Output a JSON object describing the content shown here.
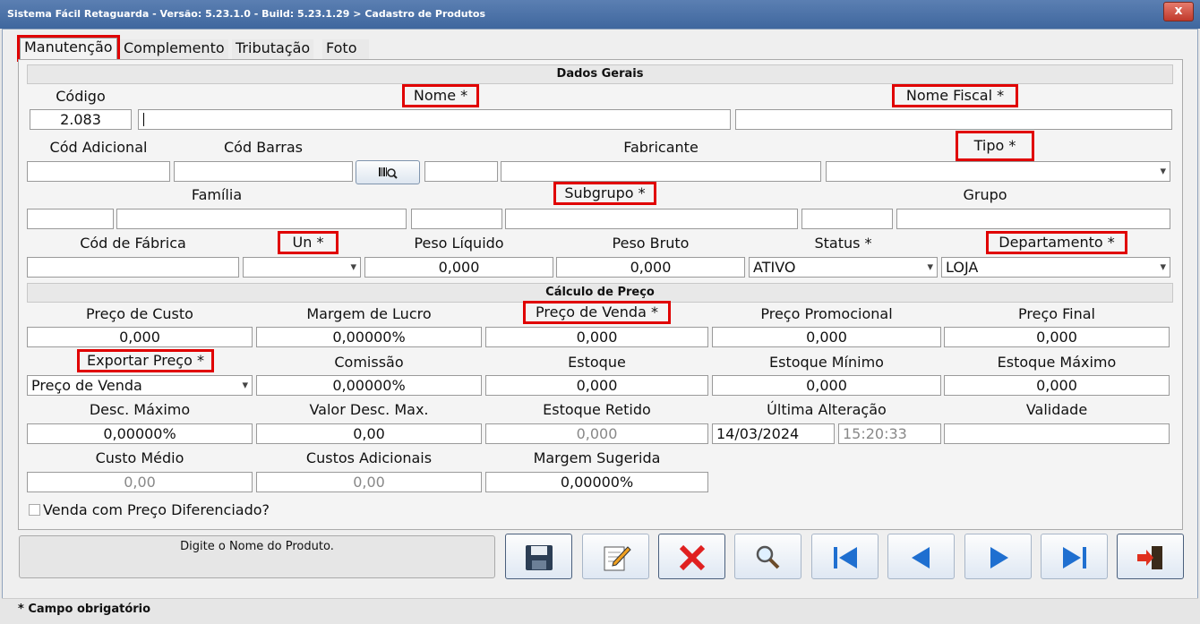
{
  "window": {
    "title": "Sistema Fácil Retaguarda - Versão: 5.23.1.0  - Build: 5.23.1.29 > Cadastro de Produtos",
    "close_label": "x"
  },
  "tabs": [
    "Manutenção",
    "Complemento",
    "Tributação",
    "Foto"
  ],
  "sections": {
    "general": "Dados Gerais",
    "price": "Cálculo de Preço"
  },
  "labels": {
    "codigo": "Código",
    "nome": "Nome *",
    "nome_fiscal": "Nome Fiscal *",
    "cod_adicional": "Cód Adicional",
    "cod_barras": "Cód Barras",
    "fabricante": "Fabricante",
    "tipo": "Tipo *",
    "familia": "Família",
    "subgrupo": "Subgrupo *",
    "grupo": "Grupo",
    "cod_fabrica": "Cód de Fábrica",
    "un": "Un *",
    "peso_liquido": "Peso Líquido",
    "peso_bruto": "Peso Bruto",
    "status": "Status *",
    "departamento": "Departamento *",
    "preco_custo": "Preço de Custo",
    "margem_lucro": "Margem de Lucro",
    "preco_venda": "Preço de Venda *",
    "preco_promocional": "Preço Promocional",
    "preco_final": "Preço Final",
    "exportar_preco": "Exportar Preço *",
    "comissao": "Comissão",
    "estoque": "Estoque",
    "estoque_minimo": "Estoque Mínimo",
    "estoque_maximo": "Estoque Máximo",
    "desc_maximo": "Desc. Máximo",
    "valor_desc_max": "Valor Desc. Max.",
    "estoque_retido": "Estoque Retido",
    "ultima_alteracao": "Última Alteração",
    "validade": "Validade",
    "custo_medio": "Custo Médio",
    "custos_adicionais": "Custos Adicionais",
    "margem_sugerida": "Margem Sugerida",
    "venda_diferenciada": "Venda com Preço Diferenciado?"
  },
  "values": {
    "codigo": "2.083",
    "nome": "",
    "nome_fiscal": "",
    "peso_liquido": "0,000",
    "peso_bruto": "0,000",
    "status": "ATIVO",
    "departamento": "LOJA",
    "preco_custo": "0,000",
    "margem_lucro": "0,00000%",
    "preco_venda": "0,000",
    "preco_promocional": "0,000",
    "preco_final": "0,000",
    "exportar_preco": "Preço de Venda",
    "comissao": "0,00000%",
    "estoque": "0,000",
    "estoque_minimo": "0,000",
    "estoque_maximo": "0,000",
    "desc_maximo": "0,00000%",
    "valor_desc_max": "0,00",
    "estoque_retido": "0,000",
    "ultima_alteracao_data": "14/03/2024",
    "ultima_alteracao_hora": "15:20:33",
    "custo_medio": "0,00",
    "custos_adicionais": "0,00",
    "margem_sugerida": "0,00000%"
  },
  "status_message": "Digite o Nome do Produto.",
  "footer": "*  Campo obrigatório",
  "toolbar_icons": [
    "save-icon",
    "edit-icon",
    "delete-icon",
    "search-icon",
    "first-icon",
    "previous-icon",
    "next-icon",
    "last-icon",
    "exit-icon"
  ],
  "colors": {
    "highlight": "#e00000",
    "title_bar": "#4a70a6"
  }
}
